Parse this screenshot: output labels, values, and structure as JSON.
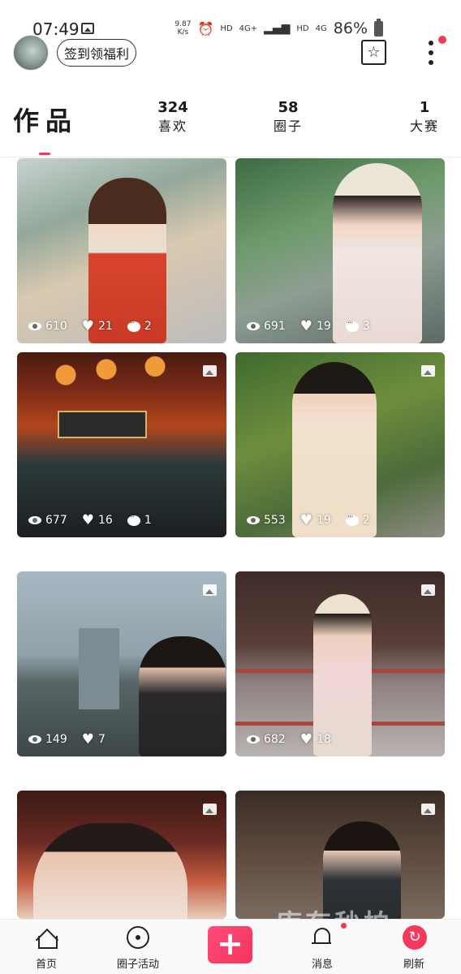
{
  "status_bar": {
    "time": "07:49",
    "net_speed_value": "9.87",
    "net_speed_unit": "K/s",
    "hd1": "HD",
    "net1": "4G+",
    "hd2": "HD",
    "net2": "4G",
    "battery": "86%"
  },
  "header": {
    "checkin_label": "签到领福利",
    "star_icon": "star-icon",
    "more_icon": "more-vertical-icon"
  },
  "stats": {
    "works_label": "作品",
    "likes": {
      "count": "324",
      "label": "喜欢"
    },
    "circles": {
      "count": "58",
      "label": "圈子"
    },
    "contests": {
      "count": "1",
      "label": "大赛"
    }
  },
  "posts": [
    {
      "views": "610",
      "likes": "21",
      "comments": "2"
    },
    {
      "views": "691",
      "likes": "19",
      "comments": "3"
    },
    {
      "views": "677",
      "likes": "16",
      "comments": "1"
    },
    {
      "views": "553",
      "likes": "19",
      "comments": "2"
    },
    {
      "views": "149",
      "likes": "7"
    },
    {
      "views": "682",
      "likes": "18"
    }
  ],
  "watermark": "库存秒拍",
  "bottom_nav": {
    "home": "首页",
    "circle_activity": "圈子活动",
    "add": "+",
    "messages": "消息",
    "refresh": "刷新"
  },
  "colors": {
    "accent": "#f4395a",
    "notification_dot": "#f23a50"
  }
}
